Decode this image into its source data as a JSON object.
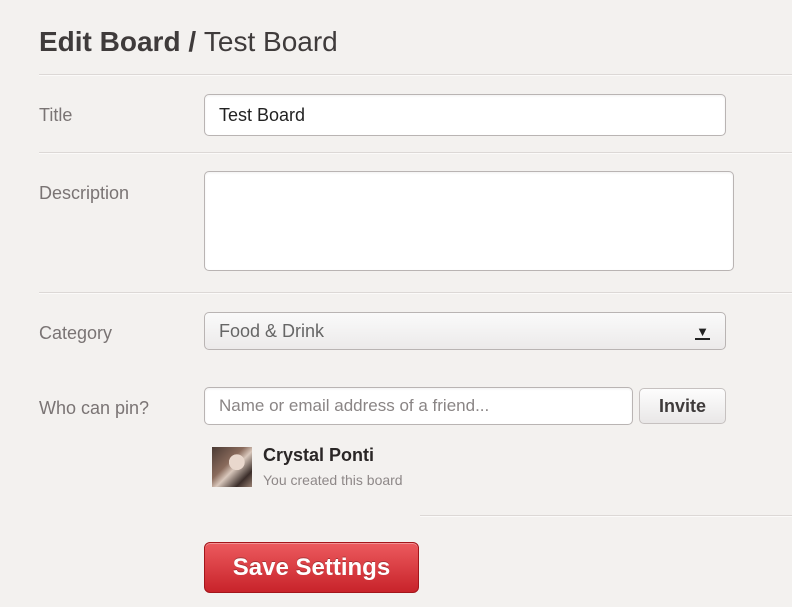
{
  "header": {
    "section": "Edit Board",
    "separator": " / ",
    "board_name": "Test Board"
  },
  "form": {
    "title": {
      "label": "Title",
      "value": "Test Board"
    },
    "description": {
      "label": "Description",
      "value": ""
    },
    "category": {
      "label": "Category",
      "selected": "Food & Drink"
    },
    "who_can_pin": {
      "label": "Who can pin?",
      "placeholder": "Name or email address of a friend...",
      "invite_label": "Invite"
    },
    "collaborators": [
      {
        "name": "Crystal Ponti",
        "note": "You created this board"
      }
    ],
    "save_label": "Save Settings"
  },
  "icons": {
    "category_dropdown": "triangle-down-icon"
  },
  "colors": {
    "save_button": "#d9343a",
    "background": "#f3f1ef"
  }
}
